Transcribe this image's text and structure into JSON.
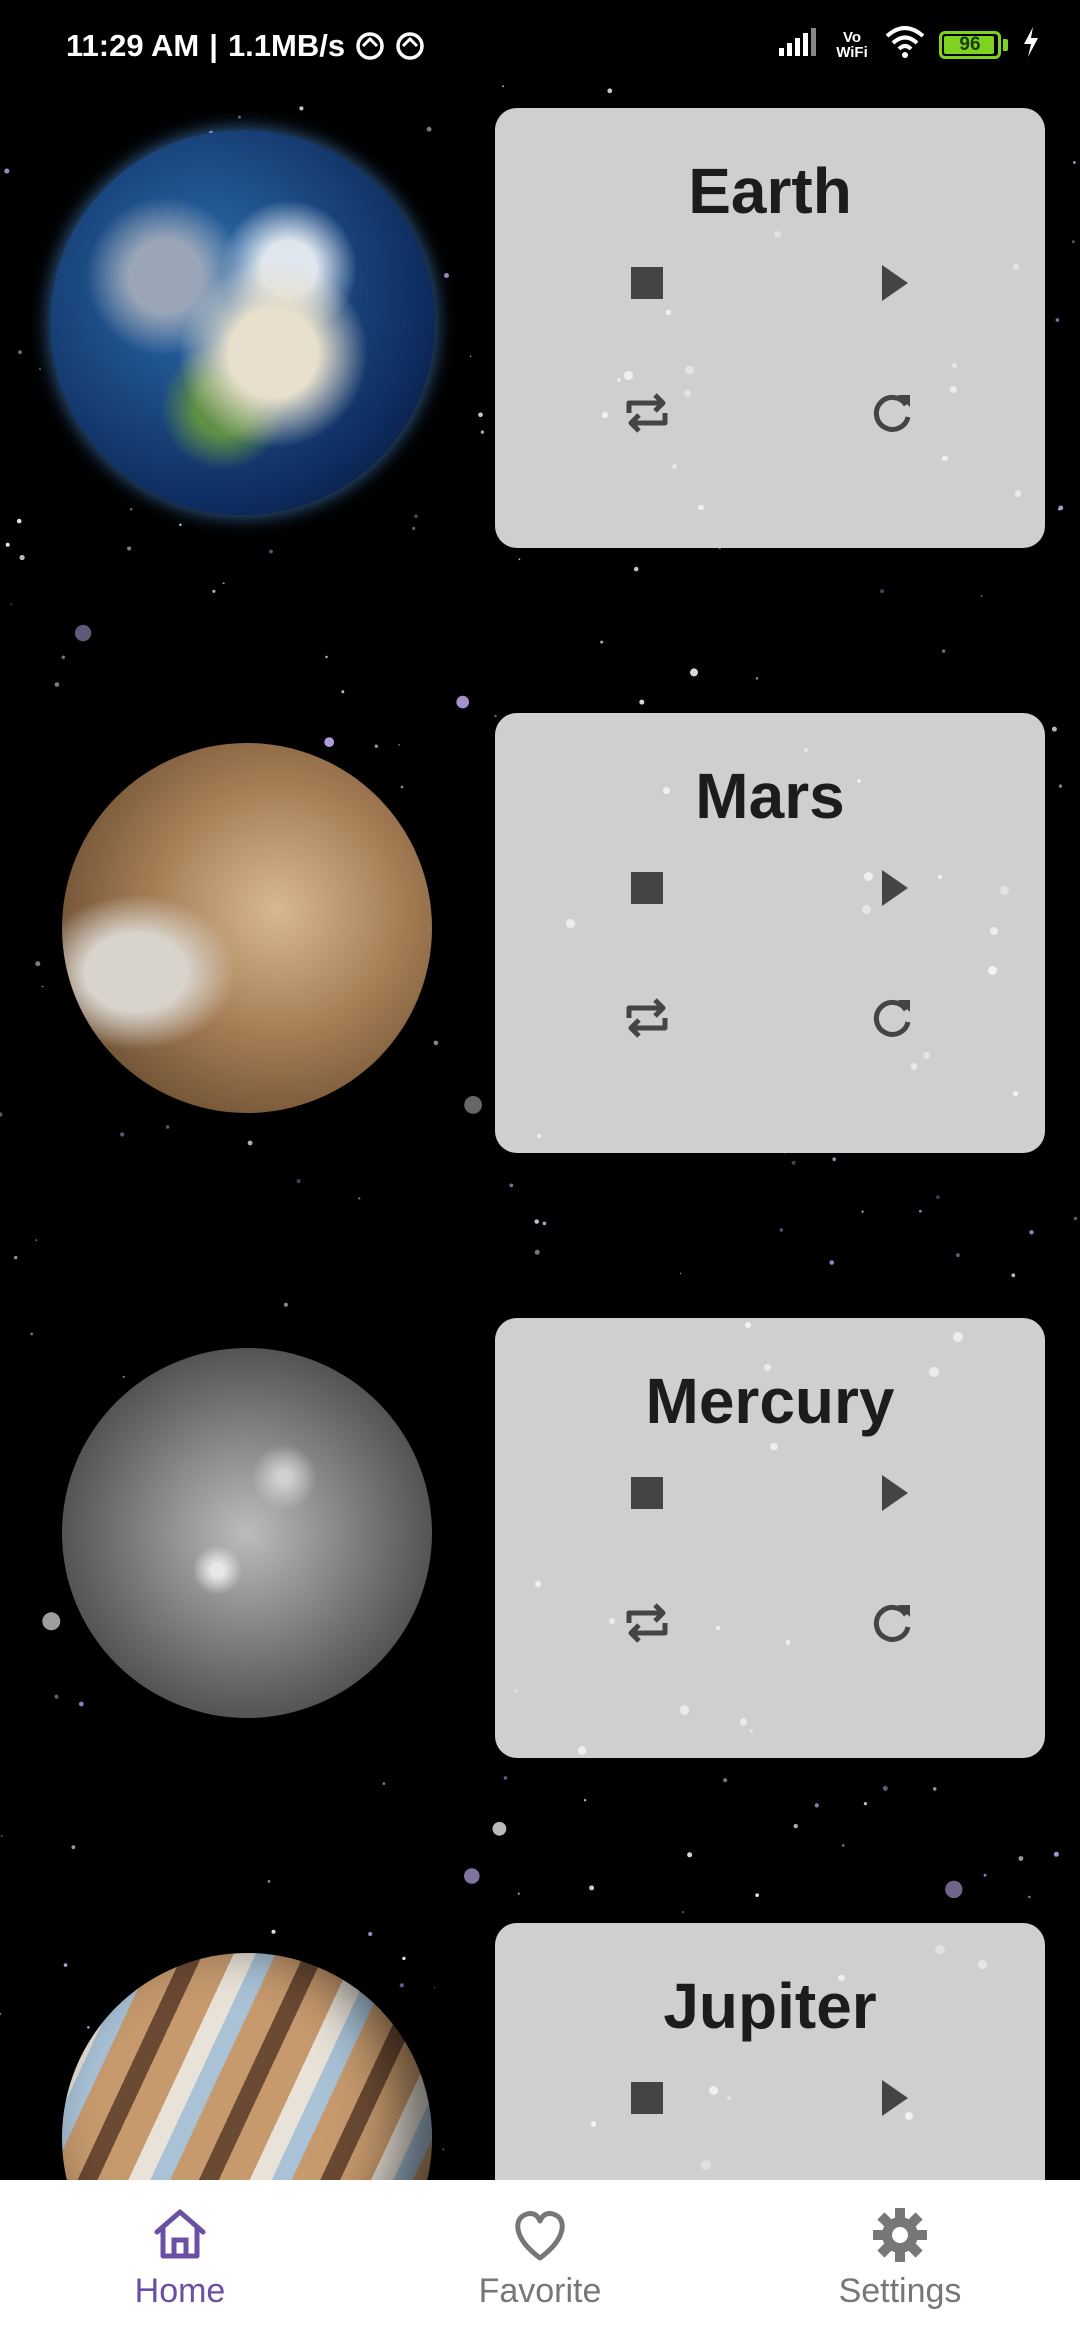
{
  "status_bar": {
    "time": "11:29 AM",
    "separator": "|",
    "net_speed": "1.1MB/s",
    "wifi_label_top": "Vo",
    "wifi_label_bottom": "WiFi",
    "battery": "96",
    "battery_level": 0.96
  },
  "planets": [
    {
      "name": "Earth",
      "colors": {
        "deep": "#0d2a5c",
        "mid": "#2d6fb0",
        "light": "#e8e0cc",
        "land": "#5f8f45"
      }
    },
    {
      "name": "Mars",
      "colors": {
        "deep": "#4a3520",
        "mid": "#a27a52",
        "light": "#d9b88f"
      }
    },
    {
      "name": "Mercury",
      "colors": {
        "deep": "#2a2a2a",
        "mid": "#6a6a6a",
        "light": "#bcbcbc"
      }
    },
    {
      "name": "Jupiter",
      "colors": {
        "deep": "#6b4a33",
        "mid": "#c79a6e",
        "light": "#e8e2d8",
        "band": "#a9c2d6"
      }
    }
  ],
  "icons": {
    "stop": "stop-icon",
    "play": "play-icon",
    "repeat": "repeat-icon",
    "replay": "replay-icon"
  },
  "colors": {
    "card_bg": "#cfcfcf",
    "icon": "#444444",
    "nav_active": "#6a4fa3",
    "nav_inactive": "#777777",
    "battery": "#7ed321"
  },
  "nav": {
    "items": [
      {
        "label": "Home",
        "icon": "home-icon",
        "active": true
      },
      {
        "label": "Favorite",
        "icon": "heart-icon",
        "active": false
      },
      {
        "label": "Settings",
        "icon": "gear-icon",
        "active": false
      }
    ]
  }
}
